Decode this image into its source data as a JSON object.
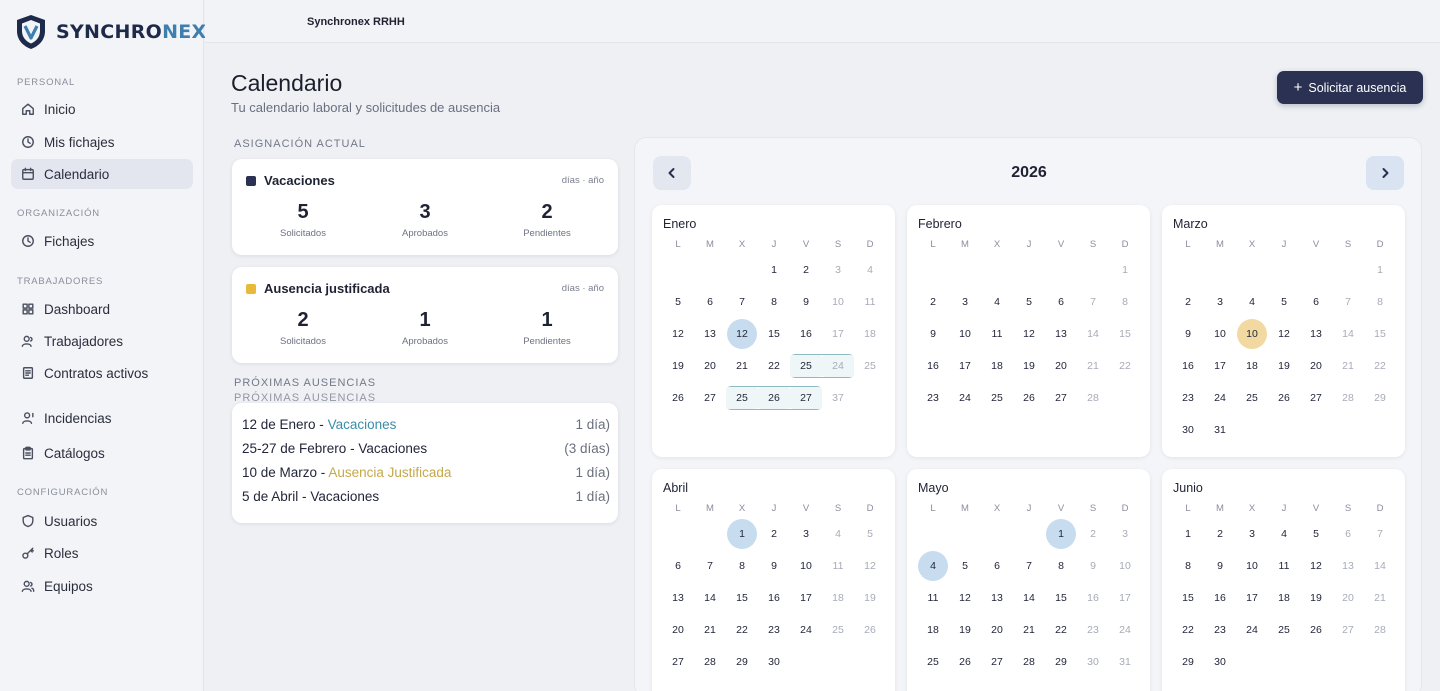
{
  "brand": {
    "text_main": "SYNCHRO",
    "text_accent": "NEX"
  },
  "topbar": {
    "app_name": "Synchronex RRHH"
  },
  "sidebar": {
    "sections": [
      {
        "title": "PERSONAL",
        "items": [
          {
            "label": "Inicio",
            "icon": "home-icon"
          },
          {
            "label": "Mis fichajes",
            "icon": "clock-icon"
          },
          {
            "label": "Calendario",
            "icon": "calendar-icon",
            "active": true
          }
        ]
      },
      {
        "title": "ORGANIZACIÓN",
        "items": [
          {
            "label": "Fichajes",
            "icon": "clock-icon"
          }
        ]
      },
      {
        "title": "TRABAJADORES",
        "items": [
          {
            "label": "Dashboard",
            "icon": "grid-icon"
          },
          {
            "label": "Trabajadores",
            "icon": "users-icon"
          },
          {
            "label": "Contratos activos",
            "icon": "document-icon"
          },
          {
            "label": "Incidencias",
            "icon": "user-alert-icon"
          },
          {
            "label": "Catálogos",
            "icon": "clipboard-icon"
          }
        ]
      },
      {
        "title": "CONFIGURACIÓN",
        "items": [
          {
            "label": "Usuarios",
            "icon": "shield-icon"
          },
          {
            "label": "Roles",
            "icon": "key-icon"
          },
          {
            "label": "Equipos",
            "icon": "team-icon"
          }
        ]
      }
    ]
  },
  "page": {
    "title": "Calendario",
    "subtitle": "Tu calendario laboral y solicitudes de ausencia",
    "request_button": "Solicitar ausencia"
  },
  "allocation": {
    "label": "ASIGNACIÓN ACTUAL",
    "cards": [
      {
        "name": "Vacaciones",
        "color": "#2b3152",
        "unit": "días · año",
        "stats": [
          {
            "value": "5",
            "label": "Solicitados"
          },
          {
            "value": "3",
            "label": "Aprobados"
          },
          {
            "value": "2",
            "label": "Pendientes"
          }
        ]
      },
      {
        "name": "Ausencia justificada",
        "color": "#e8b93a",
        "unit": "días · año",
        "stats": [
          {
            "value": "2",
            "label": "Solicitados"
          },
          {
            "value": "1",
            "label": "Aprobados"
          },
          {
            "value": "1",
            "label": "Pendientes"
          }
        ]
      }
    ]
  },
  "upcoming": {
    "label": "PRÓXIMAS AUSENCIAS",
    "label_echo": "PRÓXIMAS AUSENCIAS",
    "items": [
      {
        "date": "12 de Enero -",
        "type": "Vacaciones",
        "style": "blue",
        "duration": "1 día)"
      },
      {
        "date": "25-27 de Febrero -",
        "type": "Vacaciones",
        "style": "plain",
        "duration": "(3 días)"
      },
      {
        "date": "10 de Marzo -",
        "type": "Ausencia Justificada",
        "style": "gold",
        "duration": "1 día)"
      },
      {
        "date": "5 de Abril -",
        "type": "Vacaciones",
        "style": "plain",
        "duration": "1 día)"
      }
    ]
  },
  "calendar": {
    "year": "2026",
    "weekdays": [
      "L",
      "M",
      "X",
      "J",
      "V",
      "S",
      "D"
    ],
    "months": [
      {
        "name": "Enero",
        "weeks": [
          [
            "",
            "",
            "",
            "1",
            "2",
            "3",
            "4"
          ],
          [
            "5",
            "6",
            "7",
            "8",
            "9",
            "10",
            "11"
          ],
          [
            "12",
            "13",
            "12",
            "15",
            "16",
            "17",
            "18"
          ],
          [
            "19",
            "20",
            "21",
            "22",
            "25",
            "24",
            "25"
          ],
          [
            "26",
            "27",
            "25",
            "26",
            "27",
            "37",
            ""
          ]
        ]
      },
      {
        "name": "Febrero",
        "weeks": [
          [
            "",
            "",
            "",
            "",
            "",
            "",
            "1"
          ],
          [
            "2",
            "3",
            "4",
            "5",
            "6",
            "7",
            "8"
          ],
          [
            "9",
            "10",
            "11",
            "12",
            "13",
            "14",
            "15"
          ],
          [
            "16",
            "17",
            "18",
            "19",
            "20",
            "21",
            "22"
          ],
          [
            "23",
            "24",
            "25",
            "26",
            "27",
            "28",
            ""
          ]
        ]
      },
      {
        "name": "Marzo",
        "weeks": [
          [
            "",
            "",
            "",
            "",
            "",
            "",
            "1"
          ],
          [
            "2",
            "3",
            "4",
            "5",
            "6",
            "7",
            "8"
          ],
          [
            "9",
            "10",
            "10",
            "12",
            "13",
            "14",
            "15"
          ],
          [
            "16",
            "17",
            "18",
            "19",
            "20",
            "21",
            "22"
          ],
          [
            "23",
            "24",
            "25",
            "26",
            "27",
            "28",
            "29"
          ],
          [
            "30",
            "31",
            "",
            "",
            "",
            "",
            ""
          ]
        ]
      },
      {
        "name": "Abril",
        "weeks": [
          [
            "",
            "",
            "1",
            "2",
            "3",
            "4",
            "5"
          ],
          [
            "6",
            "7",
            "8",
            "9",
            "10",
            "11",
            "12"
          ],
          [
            "13",
            "14",
            "15",
            "16",
            "17",
            "18",
            "19"
          ],
          [
            "20",
            "21",
            "22",
            "23",
            "24",
            "25",
            "26"
          ],
          [
            "27",
            "28",
            "29",
            "30",
            "",
            "",
            ""
          ]
        ]
      },
      {
        "name": "Mayo",
        "weeks": [
          [
            "",
            "",
            "",
            "",
            "1",
            "2",
            "3"
          ],
          [
            "4",
            "5",
            "6",
            "7",
            "8",
            "9",
            "10"
          ],
          [
            "11",
            "12",
            "13",
            "14",
            "15",
            "16",
            "17"
          ],
          [
            "18",
            "19",
            "20",
            "21",
            "22",
            "23",
            "24"
          ],
          [
            "25",
            "26",
            "27",
            "28",
            "29",
            "30",
            "31"
          ]
        ]
      },
      {
        "name": "Junio",
        "weeks": [
          [
            "1",
            "2",
            "3",
            "4",
            "5",
            "6",
            "7"
          ],
          [
            "8",
            "9",
            "10",
            "11",
            "12",
            "13",
            "14"
          ],
          [
            "15",
            "16",
            "17",
            "18",
            "19",
            "20",
            "21"
          ],
          [
            "22",
            "23",
            "24",
            "25",
            "26",
            "27",
            "28"
          ],
          [
            "29",
            "30",
            "",
            "",
            "",
            "",
            ""
          ]
        ]
      }
    ],
    "highlights": [
      {
        "month": 0,
        "week": 2,
        "day": 2,
        "style": "blue"
      },
      {
        "month": 2,
        "week": 2,
        "day": 2,
        "style": "gold"
      },
      {
        "month": 3,
        "week": 0,
        "day": 2,
        "style": "blue"
      },
      {
        "month": 4,
        "week": 0,
        "day": 4,
        "style": "blue"
      },
      {
        "month": 4,
        "week": 1,
        "day": 0,
        "style": "blue"
      }
    ],
    "ranges": [
      {
        "month": 0,
        "week": 3,
        "from": 4,
        "to": 5
      },
      {
        "month": 0,
        "week": 4,
        "from": 2,
        "to": 4
      }
    ]
  }
}
